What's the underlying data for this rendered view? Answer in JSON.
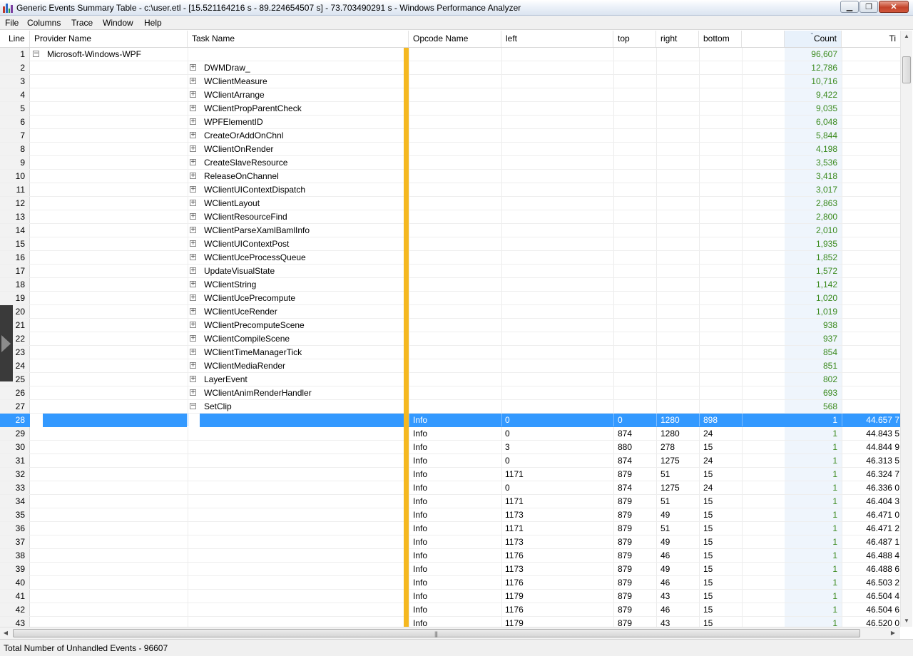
{
  "window": {
    "title": "Generic Events Summary Table - c:\\user.etl - [15.521164216 s - 89.224654507 s] - 73.703490291 s - Windows Performance Analyzer",
    "app_icon": "bar-chart-icon"
  },
  "menu": [
    "File",
    "Columns",
    "Trace",
    "Window",
    "Help"
  ],
  "columns": {
    "line": "Line",
    "provider": "Provider Name",
    "task": "Task Name",
    "opcode": "Opcode Name",
    "left": "left",
    "top": "top",
    "right": "right",
    "bottom": "bottom",
    "count": "Count",
    "time": "Ti"
  },
  "colors": {
    "selection": "#3399ff",
    "count_text": "#3b8a1e",
    "marker_bar": "#f5b820"
  },
  "rows": [
    {
      "line": "1",
      "provider": "Microsoft-Windows-WPF",
      "toggle": "−",
      "count": "96,607"
    },
    {
      "line": "2",
      "task": "DWMDraw_",
      "toggle": "+",
      "count": "12,786"
    },
    {
      "line": "3",
      "task": "WClientMeasure",
      "toggle": "+",
      "count": "10,716"
    },
    {
      "line": "4",
      "task": "WClientArrange",
      "toggle": "+",
      "count": "9,422"
    },
    {
      "line": "5",
      "task": "WClientPropParentCheck",
      "toggle": "+",
      "count": "9,035"
    },
    {
      "line": "6",
      "task": "WPFElementID",
      "toggle": "+",
      "count": "6,048"
    },
    {
      "line": "7",
      "task": "CreateOrAddOnChnl",
      "toggle": "+",
      "count": "5,844"
    },
    {
      "line": "8",
      "task": "WClientOnRender",
      "toggle": "+",
      "count": "4,198"
    },
    {
      "line": "9",
      "task": "CreateSlaveResource",
      "toggle": "+",
      "count": "3,536"
    },
    {
      "line": "10",
      "task": "ReleaseOnChannel",
      "toggle": "+",
      "count": "3,418"
    },
    {
      "line": "11",
      "task": "WClientUIContextDispatch",
      "toggle": "+",
      "count": "3,017"
    },
    {
      "line": "12",
      "task": "WClientLayout",
      "toggle": "+",
      "count": "2,863"
    },
    {
      "line": "13",
      "task": "WClientResourceFind",
      "toggle": "+",
      "count": "2,800"
    },
    {
      "line": "14",
      "task": "WClientParseXamlBamlInfo",
      "toggle": "+",
      "count": "2,010"
    },
    {
      "line": "15",
      "task": "WClientUIContextPost",
      "toggle": "+",
      "count": "1,935"
    },
    {
      "line": "16",
      "task": "WClientUceProcessQueue",
      "toggle": "+",
      "count": "1,852"
    },
    {
      "line": "17",
      "task": "UpdateVisualState",
      "toggle": "+",
      "count": "1,572"
    },
    {
      "line": "18",
      "task": "WClientString",
      "toggle": "+",
      "count": "1,142"
    },
    {
      "line": "19",
      "task": "WClientUcePrecompute",
      "toggle": "+",
      "count": "1,020"
    },
    {
      "line": "20",
      "task": "WClientUceRender",
      "toggle": "+",
      "count": "1,019"
    },
    {
      "line": "21",
      "task": "WClientPrecomputeScene",
      "toggle": "+",
      "count": "938"
    },
    {
      "line": "22",
      "task": "WClientCompileScene",
      "toggle": "+",
      "count": "937"
    },
    {
      "line": "23",
      "task": "WClientTimeManagerTick",
      "toggle": "+",
      "count": "854"
    },
    {
      "line": "24",
      "task": "WClientMediaRender",
      "toggle": "+",
      "count": "851"
    },
    {
      "line": "25",
      "task": "LayerEvent",
      "toggle": "+",
      "count": "802"
    },
    {
      "line": "26",
      "task": "WClientAnimRenderHandler",
      "toggle": "+",
      "count": "693"
    },
    {
      "line": "27",
      "task": "SetClip",
      "toggle": "−",
      "count": "568"
    },
    {
      "line": "28",
      "opcode": "Info",
      "left": "0",
      "top": "0",
      "right": "1280",
      "bottom": "898",
      "count": "1",
      "time": "44.657 7",
      "selected": true
    },
    {
      "line": "29",
      "opcode": "Info",
      "left": "0",
      "top": "874",
      "right": "1280",
      "bottom": "24",
      "count": "1",
      "time": "44.843 5"
    },
    {
      "line": "30",
      "opcode": "Info",
      "left": "3",
      "top": "880",
      "right": "278",
      "bottom": "15",
      "count": "1",
      "time": "44.844 9"
    },
    {
      "line": "31",
      "opcode": "Info",
      "left": "0",
      "top": "874",
      "right": "1275",
      "bottom": "24",
      "count": "1",
      "time": "46.313 5"
    },
    {
      "line": "32",
      "opcode": "Info",
      "left": "1171",
      "top": "879",
      "right": "51",
      "bottom": "15",
      "count": "1",
      "time": "46.324 7"
    },
    {
      "line": "33",
      "opcode": "Info",
      "left": "0",
      "top": "874",
      "right": "1275",
      "bottom": "24",
      "count": "1",
      "time": "46.336 0"
    },
    {
      "line": "34",
      "opcode": "Info",
      "left": "1171",
      "top": "879",
      "right": "51",
      "bottom": "15",
      "count": "1",
      "time": "46.404 3"
    },
    {
      "line": "35",
      "opcode": "Info",
      "left": "1173",
      "top": "879",
      "right": "49",
      "bottom": "15",
      "count": "1",
      "time": "46.471 0"
    },
    {
      "line": "36",
      "opcode": "Info",
      "left": "1171",
      "top": "879",
      "right": "51",
      "bottom": "15",
      "count": "1",
      "time": "46.471 2"
    },
    {
      "line": "37",
      "opcode": "Info",
      "left": "1173",
      "top": "879",
      "right": "49",
      "bottom": "15",
      "count": "1",
      "time": "46.487 1"
    },
    {
      "line": "38",
      "opcode": "Info",
      "left": "1176",
      "top": "879",
      "right": "46",
      "bottom": "15",
      "count": "1",
      "time": "46.488 4"
    },
    {
      "line": "39",
      "opcode": "Info",
      "left": "1173",
      "top": "879",
      "right": "49",
      "bottom": "15",
      "count": "1",
      "time": "46.488 6"
    },
    {
      "line": "40",
      "opcode": "Info",
      "left": "1176",
      "top": "879",
      "right": "46",
      "bottom": "15",
      "count": "1",
      "time": "46.503 2"
    },
    {
      "line": "41",
      "opcode": "Info",
      "left": "1179",
      "top": "879",
      "right": "43",
      "bottom": "15",
      "count": "1",
      "time": "46.504 4"
    },
    {
      "line": "42",
      "opcode": "Info",
      "left": "1176",
      "top": "879",
      "right": "46",
      "bottom": "15",
      "count": "1",
      "time": "46.504 6"
    },
    {
      "line": "43",
      "opcode": "Info",
      "left": "1179",
      "top": "879",
      "right": "43",
      "bottom": "15",
      "count": "1",
      "time": "46.520 0"
    }
  ],
  "status": "Total Number of Unhandled Events - 96607"
}
